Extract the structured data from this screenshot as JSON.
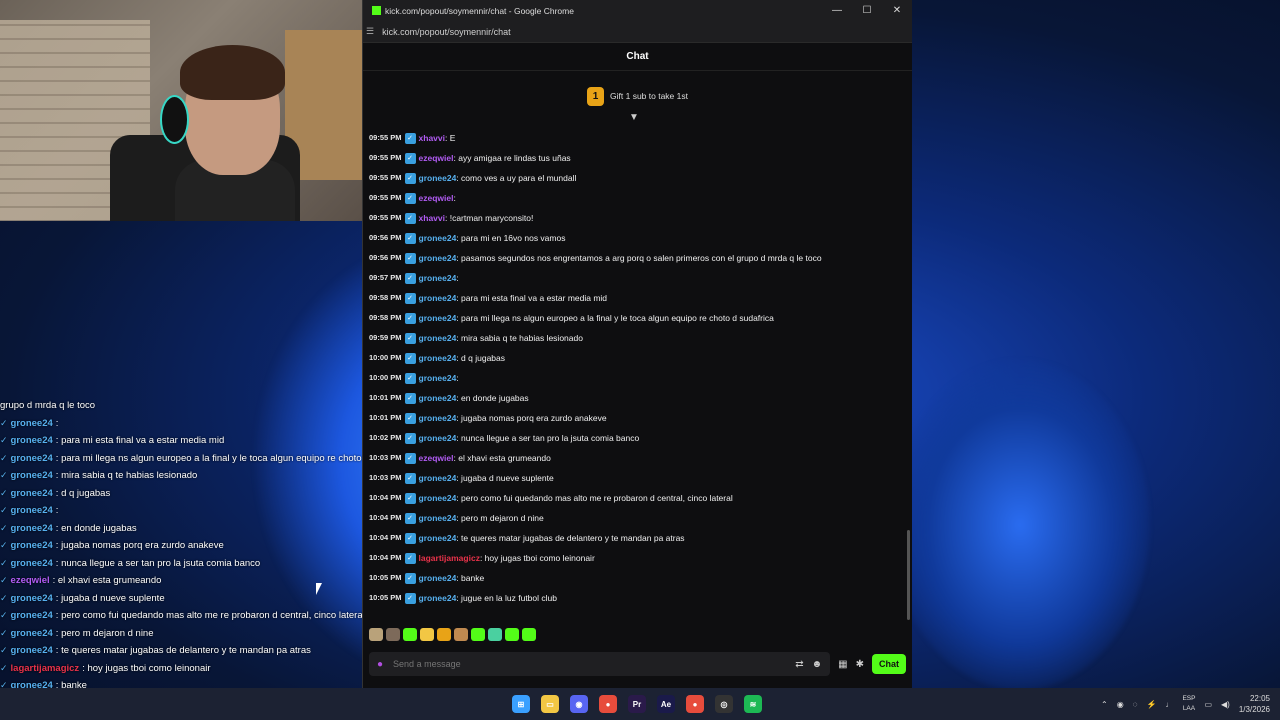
{
  "window": {
    "title": "kick.com/popout/soymennir/chat - Google Chrome",
    "url": "kick.com/popout/soymennir/chat",
    "minimize_glyph": "—",
    "maximize_glyph": "☐",
    "close_glyph": "✕"
  },
  "chat": {
    "header": "Chat",
    "gift_rank": "1",
    "gift_text": "Gift 1 sub to take 1st",
    "input_placeholder": "Send a message",
    "send_label": "Chat",
    "messages": [
      {
        "time": "09:55 PM",
        "user": "xhavvi",
        "color": "#b25cf4",
        "text": ": E"
      },
      {
        "time": "09:55 PM",
        "user": "ezeqwiel",
        "color": "#b25cf4",
        "text": ": ayy amigaa re lindas tus uñas"
      },
      {
        "time": "09:55 PM",
        "user": "gronee24",
        "color": "#57b1f0",
        "text": ": como ves a uy para el mundall"
      },
      {
        "time": "09:55 PM",
        "user": "ezeqwiel",
        "color": "#b25cf4",
        "text": ":"
      },
      {
        "time": "09:55 PM",
        "user": "xhavvi",
        "color": "#b25cf4",
        "text": ": !cartman maryconsito!"
      },
      {
        "time": "09:56 PM",
        "user": "gronee24",
        "color": "#57b1f0",
        "text": ": para mi en 16vo nos vamos"
      },
      {
        "time": "09:56 PM",
        "user": "gronee24",
        "color": "#57b1f0",
        "text": ": pasamos segundos nos engrentamos a arg porq o salen primeros con el grupo d mrda q le toco"
      },
      {
        "time": "09:57 PM",
        "user": "gronee24",
        "color": "#57b1f0",
        "text": ":"
      },
      {
        "time": "09:58 PM",
        "user": "gronee24",
        "color": "#57b1f0",
        "text": ": para mi esta final va a estar media mid"
      },
      {
        "time": "09:58 PM",
        "user": "gronee24",
        "color": "#57b1f0",
        "text": ": para mi llega ns algun europeo a la final y le toca algun equipo re choto d sudafrica"
      },
      {
        "time": "09:59 PM",
        "user": "gronee24",
        "color": "#57b1f0",
        "text": ": mira sabia q te habias lesionado"
      },
      {
        "time": "10:00 PM",
        "user": "gronee24",
        "color": "#57b1f0",
        "text": ": d q jugabas"
      },
      {
        "time": "10:00 PM",
        "user": "gronee24",
        "color": "#57b1f0",
        "text": ":"
      },
      {
        "time": "10:01 PM",
        "user": "gronee24",
        "color": "#57b1f0",
        "text": ": en donde jugabas"
      },
      {
        "time": "10:01 PM",
        "user": "gronee24",
        "color": "#57b1f0",
        "text": ": jugaba nomas porq era zurdo anakeve"
      },
      {
        "time": "10:02 PM",
        "user": "gronee24",
        "color": "#57b1f0",
        "text": ": nunca llegue a ser tan pro la jsuta comia banco"
      },
      {
        "time": "10:03 PM",
        "user": "ezeqwiel",
        "color": "#b25cf4",
        "text": ": el xhavi esta grumeando"
      },
      {
        "time": "10:03 PM",
        "user": "gronee24",
        "color": "#57b1f0",
        "text": ": jugaba d nueve suplente"
      },
      {
        "time": "10:04 PM",
        "user": "gronee24",
        "color": "#57b1f0",
        "text": ": pero como fui quedando mas alto me re probaron d central, cinco lateral"
      },
      {
        "time": "10:04 PM",
        "user": "gronee24",
        "color": "#57b1f0",
        "text": ": pero m dejaron d nine"
      },
      {
        "time": "10:04 PM",
        "user": "gronee24",
        "color": "#57b1f0",
        "text": ": te queres matar jugabas de delantero y te mandan pa atras"
      },
      {
        "time": "10:04 PM",
        "user": "lagartijamagicz",
        "color": "#e8324a",
        "text": ": hoy jugas tboi como leinonair"
      },
      {
        "time": "10:05 PM",
        "user": "gronee24",
        "color": "#57b1f0",
        "text": ": banke"
      },
      {
        "time": "10:05 PM",
        "user": "gronee24",
        "color": "#57b1f0",
        "text": ": jugue en la luz futbol club"
      }
    ]
  },
  "overlay": {
    "lines": [
      {
        "user": "",
        "color": "#ffffff",
        "text": "grupo d mrda q le toco"
      },
      {
        "user": "gronee24",
        "color": "#57b1f0",
        "text": ":"
      },
      {
        "user": "gronee24",
        "color": "#57b1f0",
        "text": ": para mi esta final va a estar media mid"
      },
      {
        "user": "gronee24",
        "color": "#57b1f0",
        "text": ": para mi llega ns algun europeo a la final y le toca algun equipo re choto d sudafrica"
      },
      {
        "user": "gronee24",
        "color": "#57b1f0",
        "text": ": mira sabia q te habias lesionado"
      },
      {
        "user": "gronee24",
        "color": "#57b1f0",
        "text": ": d q jugabas"
      },
      {
        "user": "gronee24",
        "color": "#57b1f0",
        "text": ":"
      },
      {
        "user": "gronee24",
        "color": "#57b1f0",
        "text": ": en donde jugabas"
      },
      {
        "user": "gronee24",
        "color": "#57b1f0",
        "text": ": jugaba nomas porq era zurdo anakeve"
      },
      {
        "user": "gronee24",
        "color": "#57b1f0",
        "text": ": nunca llegue a ser tan pro la jsuta comia banco"
      },
      {
        "user": "ezeqwiel",
        "color": "#b25cf4",
        "text": ": el xhavi esta grumeando"
      },
      {
        "user": "gronee24",
        "color": "#57b1f0",
        "text": ": jugaba d nueve suplente"
      },
      {
        "user": "gronee24",
        "color": "#57b1f0",
        "text": ": pero como fui quedando mas alto me re probaron d central, cinco lateral"
      },
      {
        "user": "gronee24",
        "color": "#57b1f0",
        "text": ": pero m dejaron d nine"
      },
      {
        "user": "gronee24",
        "color": "#57b1f0",
        "text": ": te queres matar jugabas de delantero y te mandan pa atras"
      },
      {
        "user": "lagartijamagicz",
        "color": "#e8324a",
        "text": ": hoy jugas tboi como leinonair"
      },
      {
        "user": "gronee24",
        "color": "#57b1f0",
        "text": ": banke"
      },
      {
        "user": "gronee24",
        "color": "#57b1f0",
        "text": ": jugue en la luz futbol club"
      }
    ]
  },
  "taskbar": {
    "apps": [
      {
        "name": "start-icon",
        "color": "#3aa0ff",
        "glyph": "⊞"
      },
      {
        "name": "file-explorer-icon",
        "color": "#f2c744",
        "glyph": "▭"
      },
      {
        "name": "discord-icon",
        "color": "#5865f2",
        "glyph": "◉"
      },
      {
        "name": "chrome-icon",
        "color": "#e74c3c",
        "glyph": "●"
      },
      {
        "name": "premiere-icon",
        "color": "#2a1a4a",
        "glyph": "Pr"
      },
      {
        "name": "after-effects-icon",
        "color": "#1a1a4a",
        "glyph": "Ae"
      },
      {
        "name": "chrome-active-icon",
        "color": "#e74c3c",
        "glyph": "●"
      },
      {
        "name": "obs-icon",
        "color": "#333333",
        "glyph": "◎"
      },
      {
        "name": "spotify-icon",
        "color": "#1db954",
        "glyph": "≋"
      }
    ],
    "lang_top": "ESP",
    "lang_bottom": "LAA",
    "time": "22:05",
    "date": "1/3/2026"
  }
}
